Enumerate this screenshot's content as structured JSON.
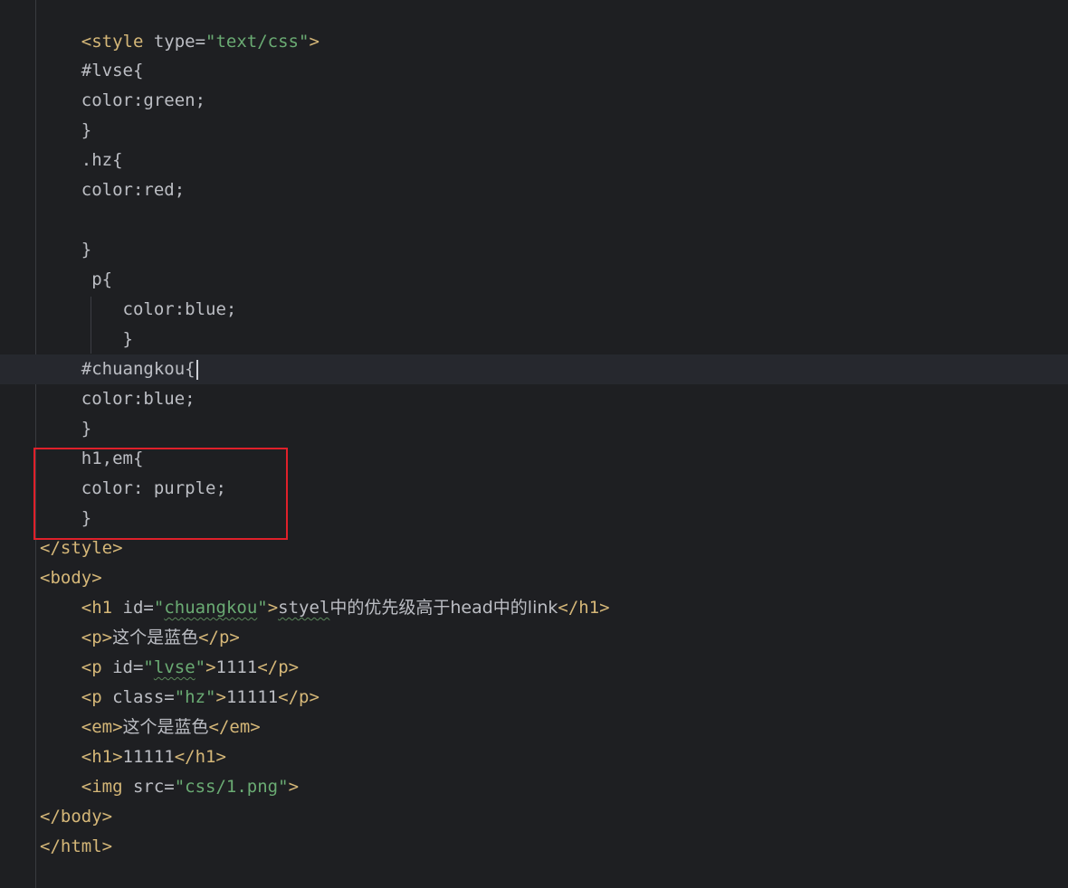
{
  "editor": {
    "lines": {
      "l1": {
        "open": "<style",
        "attr": " type=",
        "value": "\"text/css\"",
        "close": ">"
      },
      "l3": "#lvse{",
      "l4": "color:green;",
      "l5": "}",
      "l6": ".hz{",
      "l7": "color:red;",
      "l9": "}",
      "l10": "p{",
      "l11": "color:blue;",
      "l12": "}",
      "l13": "#chuangkou{",
      "l14": "color:blue;",
      "l15": "}",
      "l16": "h1,em{",
      "l17": "color: purple;",
      "l18": "}",
      "l19": "</style>",
      "l20": "<body>",
      "l21": {
        "open": "<h1",
        "attr": " id=",
        "value_q1": "\"",
        "value": "chuangkou",
        "value_q2": "\"",
        "close": ">",
        "text_word": "styel",
        "text_rest": "中的优先级高于head中的link",
        "end": "</h1>"
      },
      "l22": {
        "open": "<p>",
        "text": "这个是蓝色",
        "end": "</p>"
      },
      "l23": {
        "open": "<p",
        "attr": " id=",
        "value_q1": "\"",
        "value": "lvse",
        "value_q2": "\"",
        "close": ">",
        "text": "1111",
        "end": "</p>"
      },
      "l24": {
        "open": "<p",
        "attr": " class=",
        "value": "\"hz\"",
        "close": ">",
        "text": "11111",
        "end": "</p>"
      },
      "l25": {
        "open": "<em>",
        "text": "这个是蓝色",
        "end": "</em>"
      },
      "l26": {
        "open": "<h1>",
        "text": "11111",
        "end": "</h1>"
      },
      "l27": {
        "open": "<img",
        "attr": " src=",
        "value": "\"css/1.png\"",
        "close": ">"
      },
      "l28": "</body>",
      "l29": "</html>"
    },
    "highlight_color": "#e0202a"
  },
  "colors": {
    "background": "#1e1f22",
    "tag": "#d5b778",
    "string": "#6aab73",
    "text": "#bcbec4"
  }
}
